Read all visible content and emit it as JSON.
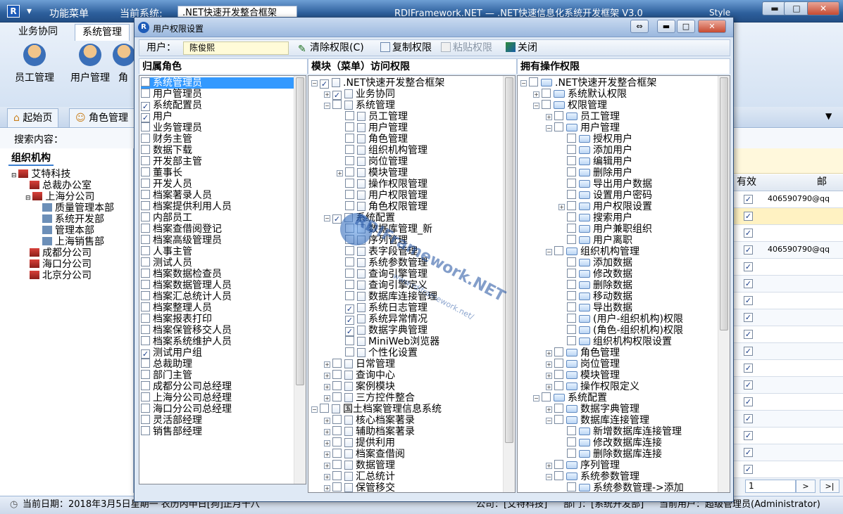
{
  "main": {
    "function_menu": "功能菜单",
    "current_system_label": "当前系统:",
    "current_system_value": ".NET快速开发整合框架",
    "title": "RDIFramework.NET — .NET快速信息化系统开发框架 V3.0",
    "style_label": "Style",
    "ribbon_tabs": [
      "业务协同",
      "系统管理"
    ],
    "ribbon_buttons": [
      "员工管理",
      "用户管理",
      "角"
    ],
    "doc_tabs": [
      "起始页",
      "角色管理"
    ],
    "search_label": "搜索内容：",
    "org_tab": "组织机构",
    "org_tree": [
      "艾特科技",
      "总裁办公室",
      "上海分公司",
      "质量管理本部",
      "系统开发部",
      "管理本部",
      "上海销售部",
      "成都分公司",
      "海口分公司",
      "北京分公司"
    ],
    "grid_header_valid": "有效",
    "grid_header_mail": "邮",
    "grid_email": "406590790@qq",
    "pager_value": "1",
    "status": {
      "date": "当前日期：2018年3月5日星期一 农历丙申日[狗]正月十八",
      "company": "公司：[艾特科技]",
      "department": "部门：[系统开发部]",
      "current_user": "当前用户：超级管理员(Administrator)"
    }
  },
  "dialog": {
    "title": "用户权限设置",
    "user_label": "用户：",
    "user_value": "陈俊熙",
    "toolbar": {
      "clear": "清除权限(C)",
      "copy": "复制权限",
      "paste": "粘贴权限",
      "close": "关闭"
    },
    "pane_titles": {
      "roles": "归属角色",
      "modules": "模块（菜单）访问权限",
      "owned": "拥有操作权限"
    },
    "roles": [
      {
        "label": "系统管理员",
        "checked": false,
        "selected": true
      },
      {
        "label": "用户管理员",
        "checked": false
      },
      {
        "label": "系统配置员",
        "checked": true
      },
      {
        "label": "用户",
        "checked": true
      },
      {
        "label": "业务管理员",
        "checked": false
      },
      {
        "label": "财务主管",
        "checked": false
      },
      {
        "label": "数据下载",
        "checked": false
      },
      {
        "label": "开发部主管",
        "checked": false
      },
      {
        "label": "董事长",
        "checked": false
      },
      {
        "label": "开发人员",
        "checked": false
      },
      {
        "label": "档案著录人员",
        "checked": false
      },
      {
        "label": "档案提供利用人员",
        "checked": false
      },
      {
        "label": "内部员工",
        "checked": false
      },
      {
        "label": "档案查借阅登记",
        "checked": false
      },
      {
        "label": "档案高级管理员",
        "checked": false
      },
      {
        "label": "人事主管",
        "checked": false
      },
      {
        "label": "测试人员",
        "checked": false
      },
      {
        "label": "档案数据检查员",
        "checked": false
      },
      {
        "label": "档案数据管理人员",
        "checked": false
      },
      {
        "label": "档案汇总统计人员",
        "checked": false
      },
      {
        "label": "档案整理人员",
        "checked": false
      },
      {
        "label": "档案报表打印",
        "checked": false
      },
      {
        "label": "档案保管移交人员",
        "checked": false
      },
      {
        "label": "档案系统维护人员",
        "checked": false
      },
      {
        "label": "测试用户组",
        "checked": true
      },
      {
        "label": "总裁助理",
        "checked": false
      },
      {
        "label": "部门主管",
        "checked": false
      },
      {
        "label": "成都分公司总经理",
        "checked": false
      },
      {
        "label": "上海分公司总经理",
        "checked": false
      },
      {
        "label": "海口分公司总经理",
        "checked": false
      },
      {
        "label": "灵活部经理",
        "checked": false
      },
      {
        "label": "销售部经理",
        "checked": false
      }
    ],
    "modules": [
      {
        "label": ".NET快速开发整合框架",
        "level": 0,
        "exp": "-",
        "checked": true
      },
      {
        "label": "业务协同",
        "level": 1,
        "exp": "+",
        "checked": true
      },
      {
        "label": "系统管理",
        "level": 1,
        "exp": "-",
        "checked": false
      },
      {
        "label": "员工管理",
        "level": 2,
        "exp": "",
        "checked": false
      },
      {
        "label": "用户管理",
        "level": 2,
        "exp": "",
        "checked": false
      },
      {
        "label": "角色管理",
        "level": 2,
        "exp": "",
        "checked": false
      },
      {
        "label": "组织机构管理",
        "level": 2,
        "exp": "",
        "checked": false
      },
      {
        "label": "岗位管理",
        "level": 2,
        "exp": "",
        "checked": false
      },
      {
        "label": "模块管理",
        "level": 2,
        "exp": "+",
        "checked": false
      },
      {
        "label": "操作权限管理",
        "level": 2,
        "exp": "",
        "checked": false
      },
      {
        "label": "用户权限管理",
        "level": 2,
        "exp": "",
        "checked": false
      },
      {
        "label": "角色权限管理",
        "level": 2,
        "exp": "",
        "checked": false
      },
      {
        "label": "系统配置",
        "level": 1,
        "exp": "-",
        "checked": true
      },
      {
        "label": "数据库管理_新",
        "level": 2,
        "exp": "",
        "checked": false
      },
      {
        "label": "序列管理",
        "level": 2,
        "exp": "",
        "checked": false
      },
      {
        "label": "表字段管理",
        "level": 2,
        "exp": "",
        "checked": false
      },
      {
        "label": "系统参数管理",
        "level": 2,
        "exp": "",
        "checked": false
      },
      {
        "label": "查询引擎管理",
        "level": 2,
        "exp": "",
        "checked": false
      },
      {
        "label": "查询引擎定义",
        "level": 2,
        "exp": "",
        "checked": false
      },
      {
        "label": "数据库连接管理",
        "level": 2,
        "exp": "",
        "checked": false
      },
      {
        "label": "系统日志管理",
        "level": 2,
        "exp": "",
        "checked": true
      },
      {
        "label": "系统异常情况",
        "level": 2,
        "exp": "",
        "checked": true
      },
      {
        "label": "数据字典管理",
        "level": 2,
        "exp": "",
        "checked": true
      },
      {
        "label": "MiniWeb浏览器",
        "level": 2,
        "exp": "",
        "checked": false
      },
      {
        "label": "个性化设置",
        "level": 2,
        "exp": "",
        "checked": false
      },
      {
        "label": "日常管理",
        "level": 1,
        "exp": "+",
        "checked": false
      },
      {
        "label": "查询中心",
        "level": 1,
        "exp": "+",
        "checked": false
      },
      {
        "label": "案例模块",
        "level": 1,
        "exp": "+",
        "checked": false
      },
      {
        "label": "三方控件整合",
        "level": 1,
        "exp": "+",
        "checked": false
      },
      {
        "label": "国土档案管理信息系统",
        "level": 0,
        "exp": "-",
        "checked": false
      },
      {
        "label": "核心档案著录",
        "level": 1,
        "exp": "+",
        "checked": false
      },
      {
        "label": "辅助档案著录",
        "level": 1,
        "exp": "+",
        "checked": false
      },
      {
        "label": "提供利用",
        "level": 1,
        "exp": "+",
        "checked": false
      },
      {
        "label": "档案查借阅",
        "level": 1,
        "exp": "+",
        "checked": false
      },
      {
        "label": "数据管理",
        "level": 1,
        "exp": "+",
        "checked": false
      },
      {
        "label": "汇总统计",
        "level": 1,
        "exp": "+",
        "checked": false
      },
      {
        "label": "保管移交",
        "level": 1,
        "exp": "+",
        "checked": false
      }
    ],
    "owned": [
      {
        "label": ".NET快速开发整合框架",
        "level": 0,
        "exp": "-"
      },
      {
        "label": "系统默认权限",
        "level": 1,
        "exp": "+"
      },
      {
        "label": "权限管理",
        "level": 1,
        "exp": "-"
      },
      {
        "label": "员工管理",
        "level": 2,
        "exp": "+"
      },
      {
        "label": "用户管理",
        "level": 2,
        "exp": "-"
      },
      {
        "label": "授权用户",
        "level": 3,
        "exp": ""
      },
      {
        "label": "添加用户",
        "level": 3,
        "exp": ""
      },
      {
        "label": "编辑用户",
        "level": 3,
        "exp": ""
      },
      {
        "label": "删除用户",
        "level": 3,
        "exp": ""
      },
      {
        "label": "导出用户数据",
        "level": 3,
        "exp": ""
      },
      {
        "label": "设置用户密码",
        "level": 3,
        "exp": ""
      },
      {
        "label": "用户权限设置",
        "level": 3,
        "exp": "+"
      },
      {
        "label": "搜索用户",
        "level": 3,
        "exp": ""
      },
      {
        "label": "用户兼职组织",
        "level": 3,
        "exp": ""
      },
      {
        "label": "用户离职",
        "level": 3,
        "exp": ""
      },
      {
        "label": "组织机构管理",
        "level": 2,
        "exp": "-"
      },
      {
        "label": "添加数据",
        "level": 3,
        "exp": ""
      },
      {
        "label": "修改数据",
        "level": 3,
        "exp": ""
      },
      {
        "label": "删除数据",
        "level": 3,
        "exp": ""
      },
      {
        "label": "移动数据",
        "level": 3,
        "exp": ""
      },
      {
        "label": "导出数据",
        "level": 3,
        "exp": ""
      },
      {
        "label": "(用户-组织机构)权限",
        "level": 3,
        "exp": ""
      },
      {
        "label": "(角色-组织机构)权限",
        "level": 3,
        "exp": ""
      },
      {
        "label": "组织机构权限设置",
        "level": 3,
        "exp": ""
      },
      {
        "label": "角色管理",
        "level": 2,
        "exp": "+"
      },
      {
        "label": "岗位管理",
        "level": 2,
        "exp": "+"
      },
      {
        "label": "模块管理",
        "level": 2,
        "exp": "+"
      },
      {
        "label": "操作权限定义",
        "level": 2,
        "exp": "+"
      },
      {
        "label": "系统配置",
        "level": 1,
        "exp": "-"
      },
      {
        "label": "数据字典管理",
        "level": 2,
        "exp": "+"
      },
      {
        "label": "数据库连接管理",
        "level": 2,
        "exp": "-"
      },
      {
        "label": "新增数据库连接管理",
        "level": 3,
        "exp": ""
      },
      {
        "label": "修改数据库连接",
        "level": 3,
        "exp": ""
      },
      {
        "label": "删除数据库连接",
        "level": 3,
        "exp": ""
      },
      {
        "label": "序列管理",
        "level": 2,
        "exp": "+"
      },
      {
        "label": "系统参数管理",
        "level": 2,
        "exp": "-"
      },
      {
        "label": "系统参数管理->添加",
        "level": 3,
        "exp": ""
      }
    ],
    "watermark": "RDIFramework.NET",
    "watermark_url": "www.rdiframework.net/"
  }
}
